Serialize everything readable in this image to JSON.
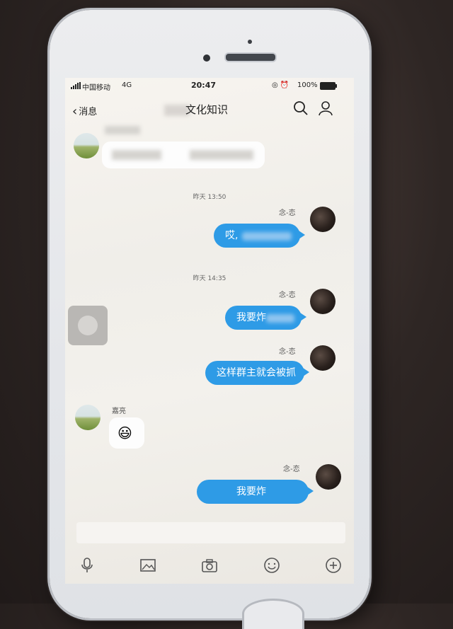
{
  "status_bar": {
    "carrier": "中国移动",
    "network": "4G",
    "time": "20:47",
    "battery": "100%"
  },
  "nav": {
    "back_label": "消息",
    "title": "文化知识",
    "icons": [
      "search-icon",
      "person-icon"
    ]
  },
  "messages": {
    "timestamp_1": "昨天 13:50",
    "timestamp_2": "昨天 14:35",
    "sender_right": "念-恋",
    "msg_1": "哎,",
    "msg_2": "我要炸",
    "msg_3": "这样群主就会被抓",
    "sender_left": "嘉亮",
    "msg_4_emoji": "😃",
    "msg_5": "我要炸"
  },
  "toolbar": {
    "icons": [
      "microphone-icon",
      "image-icon",
      "camera-icon",
      "emoji-icon",
      "plus-icon"
    ]
  },
  "colors": {
    "bubble_blue": "#2e9be6",
    "phone_body": "#e6e8ec"
  }
}
